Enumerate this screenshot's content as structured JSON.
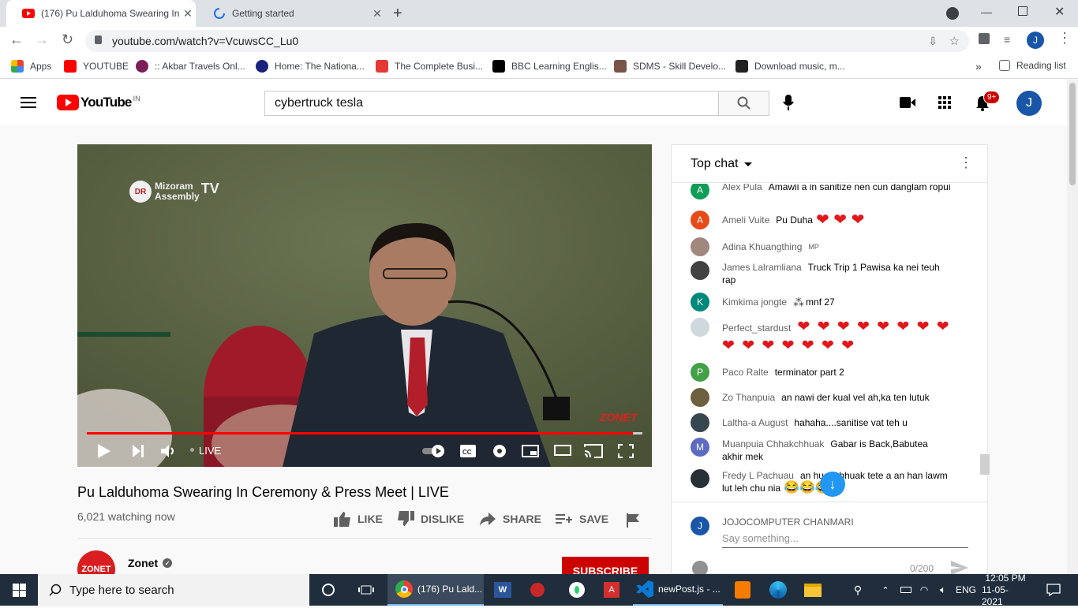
{
  "browser": {
    "tabs": [
      {
        "label": "(176) Pu Lalduhoma Swearing In",
        "active": true
      },
      {
        "label": "Getting started",
        "active": false
      }
    ],
    "url": "youtube.com/watch?v=VcuwsCC_Lu0",
    "bookmarks": [
      {
        "label": "Apps",
        "color": "#ea4335"
      },
      {
        "label": "YOUTUBE",
        "color": "#ff0000"
      },
      {
        "label": ":: Akbar Travels Onl...",
        "color": "#7b1f5a"
      },
      {
        "label": "Home: The Nationa...",
        "color": "#1a237e"
      },
      {
        "label": "The Complete Busi...",
        "color": "#e53935"
      },
      {
        "label": "BBC Learning Englis...",
        "color": "#000000"
      },
      {
        "label": "SDMS - Skill Develo...",
        "color": "#795548"
      },
      {
        "label": "Download music, m...",
        "color": "#212121"
      }
    ],
    "more_label": "»",
    "reading_list": "Reading list",
    "profile_initial": "J"
  },
  "youtube": {
    "logo_text": "YouTube",
    "country": "IN",
    "search_value": "cybertruck tesla",
    "notifications_badge": "9+",
    "avatar_initial": "J"
  },
  "video": {
    "channel_watermark_line1": "Mizoram",
    "channel_watermark_line2": "Assembly",
    "channel_watermark_tv": "TV",
    "corner_logo": "ZONET",
    "live_label": "LIVE",
    "title": "Pu Lalduhoma Swearing In Ceremony & Press Meet | LIVE",
    "views": "6,021 watching now",
    "actions": {
      "like": "LIKE",
      "dislike": "DISLIKE",
      "share": "SHARE",
      "save": "SAVE"
    },
    "channel_name": "Zonet",
    "channel_logo": "ZONET",
    "subscribe": "SUBSCRIBE"
  },
  "chat": {
    "header": "Top chat",
    "messages": [
      {
        "author": "Alex Pula",
        "text": "Amawii a in sanitize nen cun danglam ropui",
        "initial": "A",
        "color": "#0f9d58"
      },
      {
        "author": "Ameli Vuite",
        "text": "Pu Duha",
        "hearts": 3,
        "initial": "A",
        "color": "#e64a19"
      },
      {
        "author": "Adina Khuangthing",
        "text": "",
        "badge": "MP",
        "initial": "",
        "color": "#a1887f"
      },
      {
        "author": "James Lalramliana",
        "text": "Truck Trip 1 Pawisa ka nei teuh rap",
        "initial": "",
        "color": "#424242"
      },
      {
        "author": "Kimkima jongte",
        "text": "mnf 27",
        "initial": "K",
        "color": "#00897b"
      },
      {
        "author": "Perfect_stardust",
        "text": "",
        "hearts": 15,
        "initial": "",
        "color": "#cfd8dc"
      },
      {
        "author": "Paco Ralte",
        "text": "terminator part 2",
        "initial": "P",
        "color": "#43a047"
      },
      {
        "author": "Zo Thanpuia",
        "text": "an nawi der kual vel ah,ka ten lutuk",
        "initial": "",
        "color": "#6d6040"
      },
      {
        "author": "Laltha-a August",
        "text": "hahaha....sanitise vat teh u",
        "initial": "",
        "color": "#37474f"
      },
      {
        "author": "Muanpuia Chhakchhuak",
        "text": "Gabar is Back,Babutea akhir mek",
        "initial": "M",
        "color": "#5c6bc0"
      },
      {
        "author": "Fredy L Pachuau",
        "text": "an huat chhuak tete a an han lawm lut leh chu nia",
        "initial": "",
        "color": "#263238"
      }
    ],
    "input_author": "JOJOCOMPUTER CHANMARI",
    "input_placeholder": "Say something...",
    "char_count": "0/200",
    "input_initial": "J"
  },
  "taskbar": {
    "search_placeholder": "Type here to search",
    "chrome_label": "(176) Pu Lald...",
    "vscode_label": "newPost.js - ...",
    "lang": "ENG",
    "time": "12:05 PM",
    "date": "11-05-2021"
  }
}
